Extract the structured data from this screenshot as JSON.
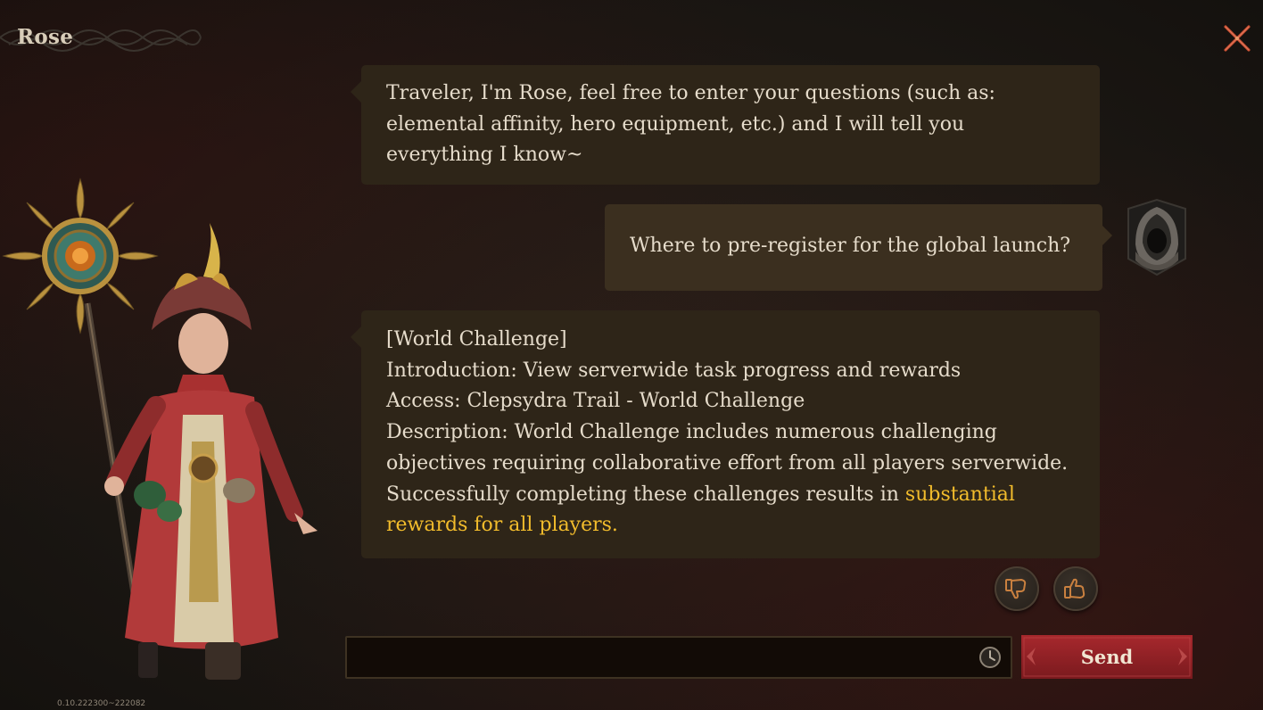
{
  "header": {
    "title": "Rose"
  },
  "icons": {
    "close": "close-icon",
    "history": "clock-icon",
    "dislike": "thumbs-down-icon",
    "like": "thumbs-up-icon"
  },
  "messages": [
    {
      "sender": "npc",
      "lines": [
        "Traveler, I'm Rose, feel free to enter your questions (such as:",
        "elemental affinity, hero equipment, etc.) and I will tell you",
        "everything I know~"
      ]
    },
    {
      "sender": "player",
      "text": "Where to pre-register for the global launch?"
    },
    {
      "sender": "npc",
      "lines": [
        "[World Challenge]",
        "Introduction: View serverwide task progress and rewards",
        "Access: Clepsydra Trail - World Challenge",
        "Description: World Challenge includes numerous challenging",
        "objectives requiring collaborative effort from all players serverwide.",
        "Successfully completing these challenges results in "
      ],
      "highlight": [
        "substantial",
        "rewards for all players."
      ]
    }
  ],
  "input": {
    "value": "",
    "placeholder": ""
  },
  "send": {
    "label": "Send"
  },
  "footer": {
    "version": "0.10.222300~222082"
  },
  "colors": {
    "background": "#1b1713",
    "bubble_npc": "#2e2518",
    "bubble_player": "#3b2f1f",
    "highlight": "#f2bc2c",
    "send_button": "#8e1f24"
  }
}
